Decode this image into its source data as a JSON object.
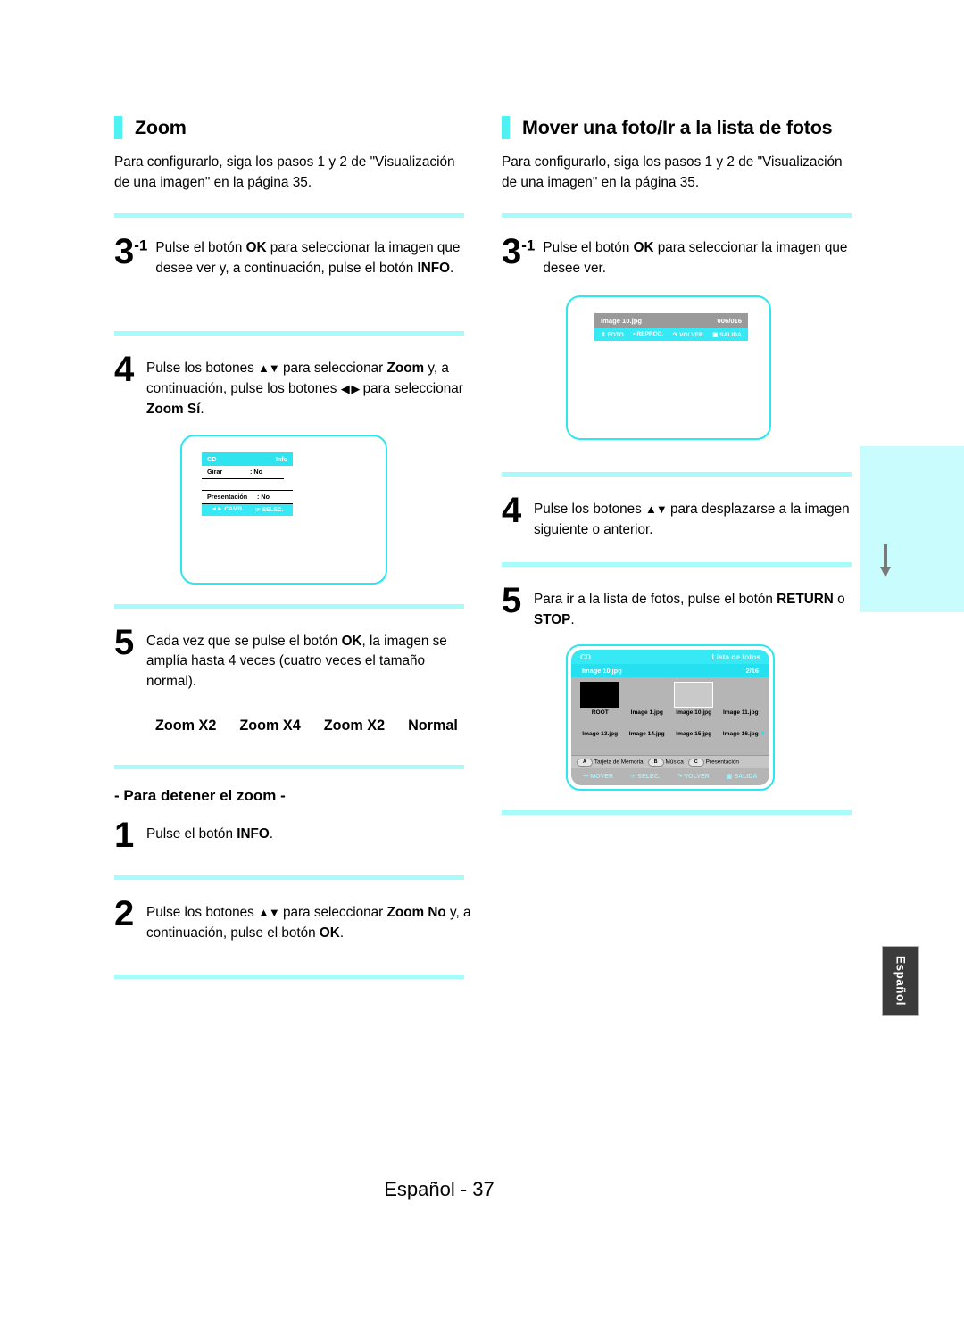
{
  "document": {
    "language": "Español",
    "page_number": "37",
    "footer_text": "Español - 37",
    "side_tab_label": "Español"
  },
  "theme": {
    "accent_cyan": "#4ff2f2",
    "divider_cyan": "#a8fbfb",
    "screen_border": "#2ee6ef",
    "osd_bar_cyan": "#37e9f4",
    "osd_title_gray": "#9a9a9a",
    "photo_list_gray": "#b5b5b5",
    "lang_tab_dark": "#3b3b3b"
  },
  "left_column": {
    "heading": "Zoom",
    "intro": "Para configurarlo, siga los pasos 1 y 2 de \"Visualización de una imagen\" en la página 35.",
    "steps": [
      {
        "number": "3",
        "superscript": "-1",
        "text_parts": [
          "Pulse el botón ",
          "OK",
          " para seleccionar la imagen que desee ver y, a continuación, pulse el botón ",
          "INFO",
          "."
        ]
      },
      {
        "number": "4",
        "superscript": "",
        "text_parts": [
          "Pulse los botones ",
          "▲▼",
          " para seleccionar ",
          "Zoom",
          " y, a continuación, pulse los botones ",
          "◀ ▶",
          " para seleccionar ",
          "Zoom Sí",
          "."
        ]
      },
      {
        "number": "5",
        "superscript": "",
        "text_parts": [
          "Cada vez que se pulse el botón ",
          "OK",
          ", la imagen se amplía hasta 4 veces (cuatro veces el tamaño normal)."
        ]
      }
    ],
    "cd_menu": {
      "title": "CD",
      "title_right": "Info",
      "rows": [
        {
          "label": "Girar",
          "value": ": No"
        },
        {
          "label": "Presentación",
          "value": ": No"
        }
      ],
      "footer_keys": [
        "◄► CAMB.",
        "☞ SELEC."
      ]
    },
    "zoom_sequence": [
      "Zoom X2",
      "Zoom X4",
      "Zoom X2",
      "Normal"
    ],
    "stop_zoom": {
      "subheading": "- Para detener el zoom  -",
      "steps": [
        {
          "number": "1",
          "text_parts": [
            "Pulse el botón ",
            "INFO",
            "."
          ]
        },
        {
          "number": "2",
          "text_parts": [
            "Pulse los botones  ",
            "▲▼",
            " para seleccionar ",
            "Zoom No",
            " y, a continuación, pulse el botón ",
            "OK",
            "."
          ]
        }
      ]
    }
  },
  "right_column": {
    "heading": "Mover una foto/Ir a la lista de fotos",
    "intro": "Para configurarlo, siga los pasos 1 y 2 de \"Visualización de una imagen\" en la página 35.",
    "steps": [
      {
        "number": "3",
        "superscript": "-1",
        "text_parts": [
          "Pulse el botón ",
          "OK",
          " para seleccionar la imagen que desee ver."
        ]
      },
      {
        "number": "4",
        "superscript": "",
        "text_parts": [
          "Pulse los botones ",
          "▲▼",
          " para desplazarse a la imagen siguiente o anterior."
        ]
      },
      {
        "number": "5",
        "superscript": "",
        "text_parts": [
          "Para ir a la lista de fotos, pulse el botón ",
          "RETURN",
          " o ",
          "STOP",
          "."
        ]
      }
    ],
    "osd_screen": {
      "file_name": "Image 10.jpg",
      "counter": "006/016",
      "keys": [
        "⇕ FOTO",
        "▪ REPROD.",
        "↷ VOLVER",
        "▣ SALIDA"
      ]
    },
    "photo_list_screen": {
      "source": "CD",
      "title": "Lista de fotos",
      "selected_file": "Image 10.jpg",
      "counter": "2/16",
      "row1": [
        {
          "label": "ROOT",
          "thumb": "folder-black"
        },
        {
          "label": "Image 1.jpg",
          "thumb": "empty"
        },
        {
          "label": "Image 10.jpg",
          "thumb": "selected"
        },
        {
          "label": "Image 11.jpg",
          "thumb": "empty"
        }
      ],
      "row2": [
        {
          "label": "Image 13.jpg"
        },
        {
          "label": "Image 14.jpg"
        },
        {
          "label": "Image 15.jpg"
        },
        {
          "label": "Image 16.jpg"
        }
      ],
      "scroll_indicator": "▼",
      "color_keys": [
        {
          "key": "A",
          "label": "Tarjeta de Memoria"
        },
        {
          "key": "B",
          "label": "Música"
        },
        {
          "key": "C",
          "label": "Presentación"
        }
      ],
      "footer_keys": [
        "✛ MOVER",
        "☞ SELEC.",
        "↷ VOLVER",
        "▣ SALIDA"
      ]
    }
  }
}
